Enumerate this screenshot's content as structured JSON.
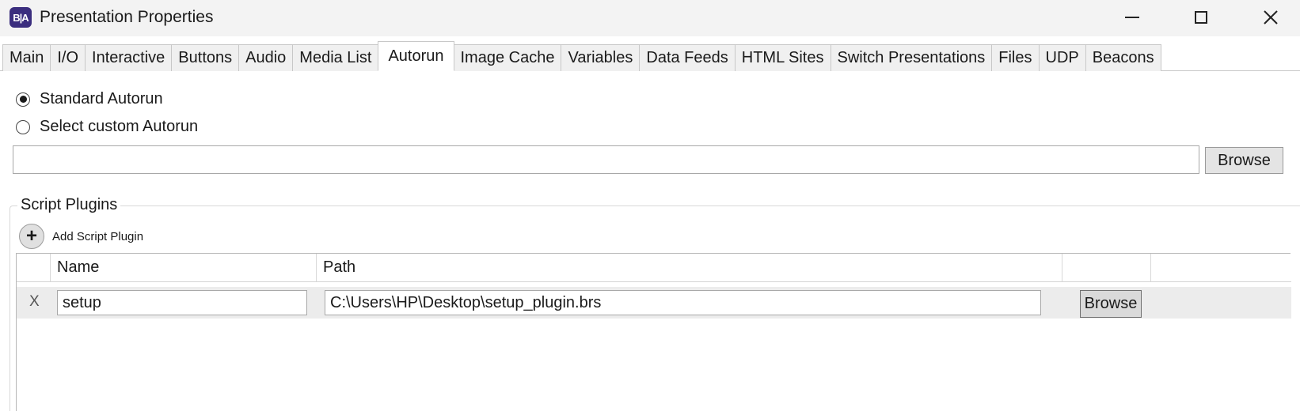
{
  "window": {
    "title": "Presentation Properties",
    "logo_text": "B|A"
  },
  "tabs": [
    {
      "label": "Main",
      "active": false
    },
    {
      "label": "I/O",
      "active": false
    },
    {
      "label": "Interactive",
      "active": false
    },
    {
      "label": "Buttons",
      "active": false
    },
    {
      "label": "Audio",
      "active": false
    },
    {
      "label": "Media List",
      "active": false
    },
    {
      "label": "Autorun",
      "active": true
    },
    {
      "label": "Image Cache",
      "active": false
    },
    {
      "label": "Variables",
      "active": false
    },
    {
      "label": "Data Feeds",
      "active": false
    },
    {
      "label": "HTML Sites",
      "active": false
    },
    {
      "label": "Switch Presentations",
      "active": false
    },
    {
      "label": "Files",
      "active": false
    },
    {
      "label": "UDP",
      "active": false
    },
    {
      "label": "Beacons",
      "active": false
    }
  ],
  "autorun": {
    "standard_label": "Standard Autorun",
    "custom_label": "Select custom Autorun",
    "selected": "standard",
    "custom_path": "",
    "browse_label": "Browse"
  },
  "script_plugins": {
    "group_title": "Script Plugins",
    "add_label": "Add Script Plugin",
    "columns": {
      "name": "Name",
      "path": "Path"
    },
    "rows": [
      {
        "delete_label": "X",
        "name": "setup",
        "path": "C:\\Users\\HP\\Desktop\\setup_plugin.brs",
        "browse_label": "Browse"
      }
    ]
  },
  "icons": {
    "minimize": "minimize-icon",
    "maximize": "maximize-icon",
    "close": "close-icon",
    "add": "plus-icon"
  }
}
